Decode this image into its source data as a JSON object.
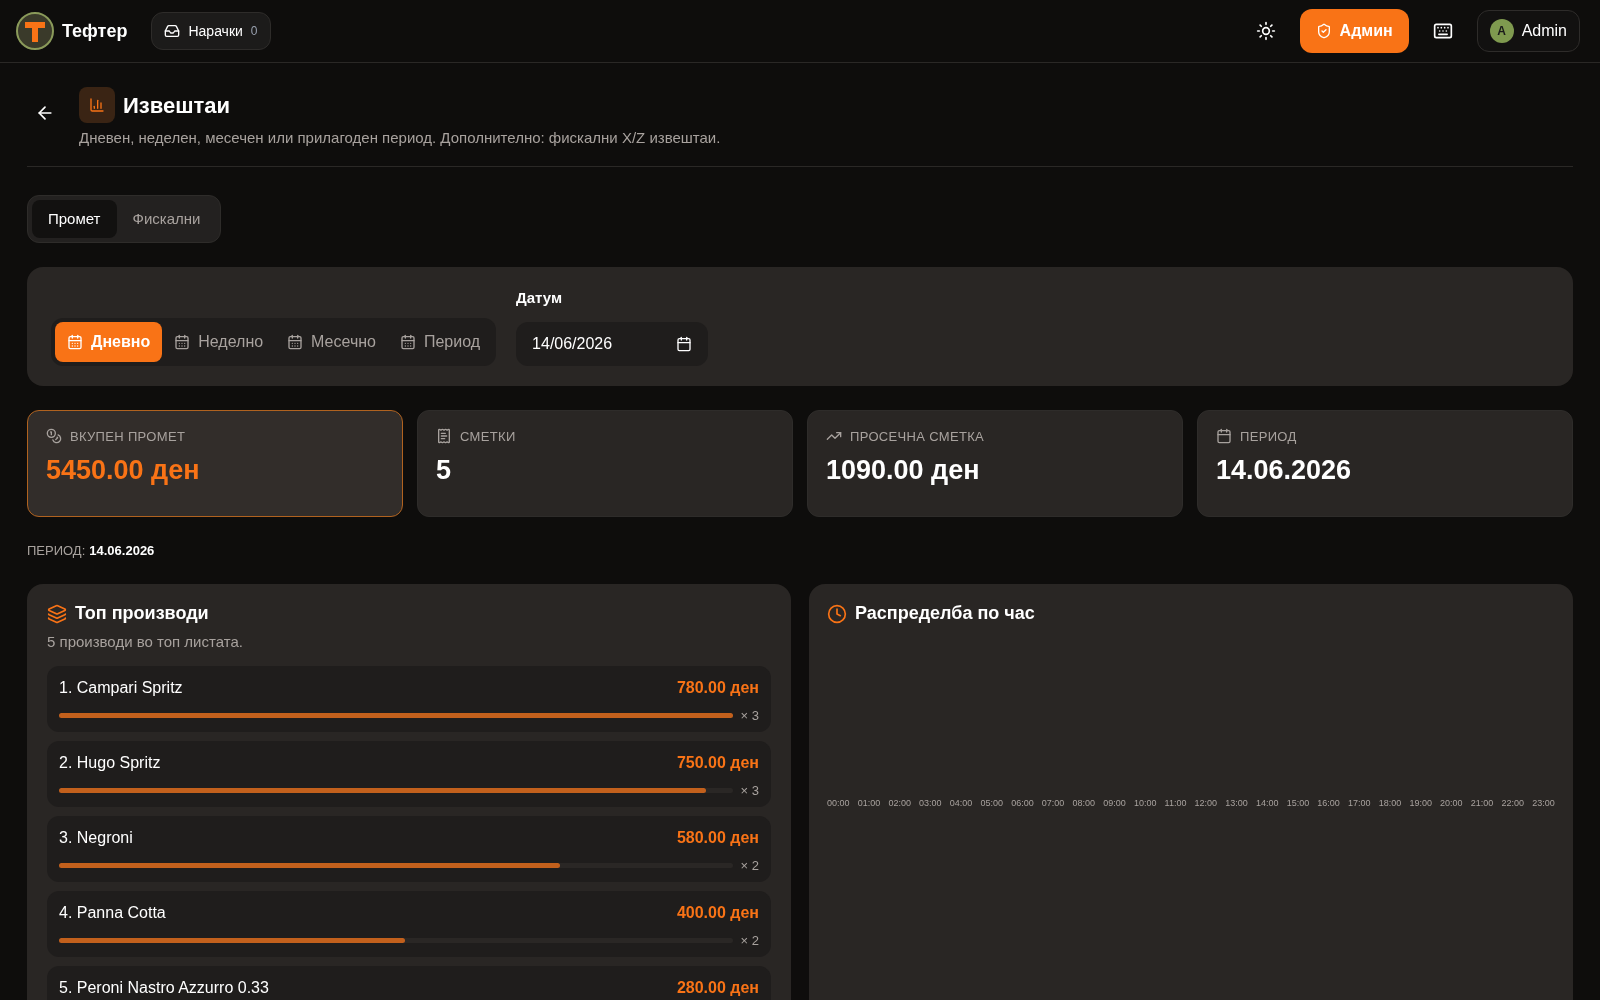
{
  "header": {
    "brand": "Тефтер",
    "orders_button": {
      "label": "Нарачки",
      "count": "0"
    },
    "role_button": "Админ",
    "user": {
      "initial": "A",
      "name": "Admin"
    }
  },
  "page": {
    "title": "Извештаи",
    "subtitle": "Дневен, неделен, месечен или прилагоден период. Дополнително: фискални X/Z извештаи."
  },
  "tabs": [
    {
      "label": "Промет",
      "selected": true
    },
    {
      "label": "Фискални",
      "selected": false
    }
  ],
  "filters": {
    "periods": [
      {
        "label": "Дневно",
        "selected": true
      },
      {
        "label": "Неделно",
        "selected": false
      },
      {
        "label": "Месечно",
        "selected": false
      },
      {
        "label": "Период",
        "selected": false
      }
    ],
    "date_label": "Датум",
    "date_value": "14/06/2026"
  },
  "stats": [
    {
      "kind": "coins",
      "label": "ВКУПЕН ПРОМЕТ",
      "value": "5450.00 ден",
      "selected": true
    },
    {
      "kind": "receipt",
      "label": "СМЕТКИ",
      "value": "5",
      "selected": false
    },
    {
      "kind": "trend",
      "label": "ПРОСЕЧНА СМЕТКА",
      "value": "1090.00 ден",
      "selected": false
    },
    {
      "kind": "calendar",
      "label": "ПЕРИОД",
      "value": "14.06.2026",
      "selected": false
    }
  ],
  "period_line": {
    "label": "ПЕРИОД:",
    "value": "14.06.2026"
  },
  "top_products": {
    "title": "Топ производи",
    "subtitle": "5 производи во топ листата.",
    "items": [
      {
        "name": "1. Campari Spritz",
        "amount": "780.00 ден",
        "count": "× 3",
        "level": 1
      },
      {
        "name": "2. Hugo Spritz",
        "amount": "750.00 ден",
        "count": "× 3",
        "level": 0.96
      },
      {
        "name": "3. Negroni",
        "amount": "580.00 ден",
        "count": "× 2",
        "level": 0.744
      },
      {
        "name": "4. Panna Cotta",
        "amount": "400.00 ден",
        "count": "× 2",
        "level": 0.513
      },
      {
        "name": "5. Peroni Nastro Azzurro 0.33",
        "amount": "280.00 ден"
      }
    ]
  },
  "hourly": {
    "title": "Распределба по час",
    "hours": [
      "00:00",
      "01:00",
      "02:00",
      "03:00",
      "04:00",
      "05:00",
      "06:00",
      "07:00",
      "08:00",
      "09:00",
      "10:00",
      "11:00",
      "12:00",
      "13:00",
      "14:00",
      "15:00",
      "16:00",
      "17:00",
      "18:00",
      "19:00",
      "20:00",
      "21:00",
      "22:00",
      "23:00"
    ]
  }
}
